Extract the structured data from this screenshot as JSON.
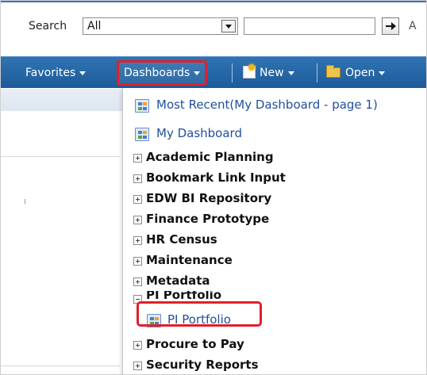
{
  "search": {
    "label": "Search",
    "scope_value": "All",
    "query_value": "",
    "trailing_text": "A"
  },
  "nav": {
    "favorites": "Favorites",
    "dashboards": "Dashboards",
    "new": "New",
    "open": "Open"
  },
  "menu": {
    "recent": "Most Recent(My Dashboard - page 1)",
    "my_dashboard": "My Dashboard",
    "folders": [
      {
        "label": "Academic Planning",
        "state": "collapsed"
      },
      {
        "label": "Bookmark Link Input",
        "state": "collapsed"
      },
      {
        "label": "EDW BI Repository",
        "state": "collapsed"
      },
      {
        "label": "Finance Prototype",
        "state": "collapsed"
      },
      {
        "label": "HR Census",
        "state": "collapsed"
      },
      {
        "label": "Maintenance",
        "state": "collapsed"
      },
      {
        "label": "Metadata",
        "state": "collapsed"
      },
      {
        "label": "PI Portfolio",
        "state": "expanded"
      },
      {
        "label": "Procure to Pay",
        "state": "collapsed"
      },
      {
        "label": "Security Reports",
        "state": "collapsed"
      }
    ],
    "pi_child": "PI Portfolio"
  },
  "colors": {
    "nav_bar": "#2068a8",
    "link": "#1f4f9e",
    "highlight": "#e0202a"
  },
  "icons": {
    "dashboard": "dashboard-icon",
    "new": "new-document-icon",
    "open": "folder-open-icon",
    "go": "arrow-right-icon"
  }
}
